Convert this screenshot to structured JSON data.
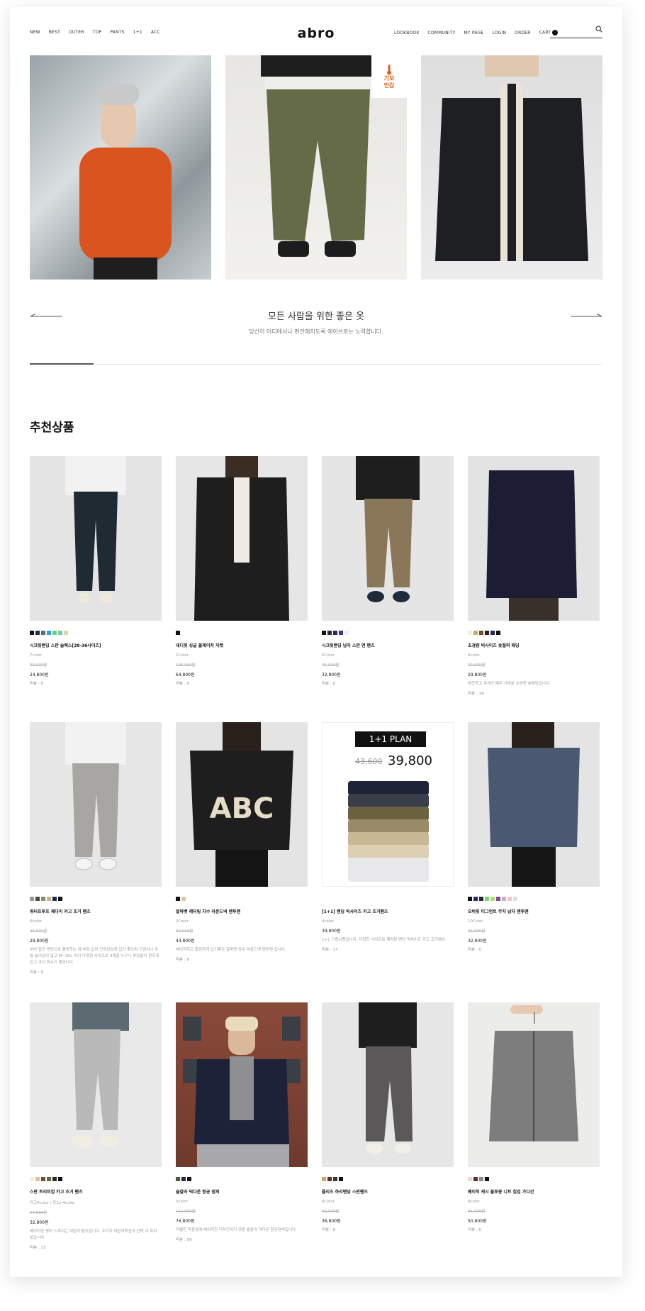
{
  "header": {
    "logo": "abro",
    "nav_left": [
      "NEW",
      "BEST",
      "OUTER",
      "TOP",
      "PANTS",
      "1+1",
      "ACC"
    ],
    "nav_right": [
      "LOOKBOOK",
      "COMMUNITY",
      "MY PAGE",
      "LOGIN",
      "ORDER",
      "CART"
    ],
    "cart_count": "0"
  },
  "hero": {
    "badge_line1": "기모",
    "badge_line2": "안감"
  },
  "slogan": {
    "title": "모든 사람을 위한 좋은 옷",
    "subtitle": "당신이 어디에서나 편안해지도록 에이브로는 노력합니다."
  },
  "section_title": "추천상품",
  "products": [
    {
      "name": "시크릿밴딩 스판 슬랙스[28-36사이즈]",
      "colors_label": "7color",
      "orig": "33,000원",
      "price": "24,800원",
      "desc": "",
      "review": "리뷰 : 0",
      "swatches": [
        "#111111",
        "#1d2a55",
        "#5b6a7a",
        "#2aa4e0",
        "#6ad17a",
        "#7bc9a8",
        "#dcd5b0"
      ]
    },
    {
      "name": "데디핏 싱글 블레이저 자켓",
      "colors_label": "1Color",
      "orig": "105,000원",
      "price": "64,800원",
      "desc": "",
      "review": "리뷰 : 0",
      "swatches": [
        "#111111"
      ]
    },
    {
      "name": "시크릿밴딩 남자 스판 면 팬츠",
      "colors_label": "5Color",
      "orig": "45,000원",
      "price": "32,800원",
      "desc": "",
      "review": "리뷰 : 0",
      "swatches": [
        "#111111",
        "#2b2b2b",
        "#1d2a6e",
        "#3a3a8a",
        "#f0f0f0"
      ]
    },
    {
      "name": "초경량 빅사이즈 숏절퍼 패딩",
      "colors_label": "6color",
      "orig": "42,000원",
      "price": "29,800원",
      "desc": "따뜻하고 무게가 매우 가벼운 초경량 숏패딩입니다.",
      "review": "리뷰 : 14",
      "swatches": [
        "#f3efe2",
        "#c8a96a",
        "#6b5330",
        "#2a1f14",
        "#1d2a55",
        "#111111"
      ]
    },
    {
      "name": "워터프루프 제다이 카고 조거 팬츠",
      "colors_label": "6color",
      "orig": "45,000원",
      "price": "29,800원",
      "desc": "허리 밑단 밴딩으로 활동하는 데 부담 없이 안정감있게 입기 좋으며 구김이나 무릎 늘어남이 없고 M~3XL 까지 다양한 사이즈로 4계절 누구나 부담없이 편하게 입고 코디 하시기 좋습니다.",
      "review": "리뷰 : 9",
      "swatches": [
        "#9a9a9a",
        "#4a4a4a",
        "#8a8a70",
        "#c9b48a",
        "#1d2a55",
        "#111111"
      ]
    },
    {
      "name": "알파벳 레터링 자수 라운드넥 맨투맨",
      "colors_label": "2Color",
      "orig": "69,000원",
      "price": "43,800원",
      "desc": "베이직하고 깔끔하게 입기좋은 알파벳 자수 라운드넥 맨투맨 입니다.",
      "review": "리뷰 : 0",
      "swatches": [
        "#111111",
        "#d9c6a8"
      ]
    },
    {
      "name": "[1+1] 밴딩 빅사이즈 카고 조거팬츠",
      "colors_label": "4color",
      "orig": "",
      "price": "39,800원",
      "desc": "1+1 기획상품입니다. 다양한 사이즈로 제작된 밴딩 빅사이즈 카고 조거팬츠",
      "review": "리뷰 : 17",
      "swatches": [],
      "plan_tag": "1+1 PLAN",
      "plan_old": "43,600",
      "plan_new": "39,800"
    },
    {
      "name": "오버핏 티그먼트 무지 남자 맨투맨",
      "colors_label": "10Color",
      "orig": "46,000원",
      "price": "32,800원",
      "desc": "",
      "review": "리뷰 : 0",
      "swatches": [
        "#111111",
        "#1d2a6e",
        "#2b2b2b",
        "#7bd17a",
        "#a6e07a",
        "#8e3fa8",
        "#b8b8b8",
        "#f0c0d0",
        "#e0e0e0"
      ]
    },
    {
      "name": "스판 트리미엄 카고 조거 팬츠",
      "colors_label": "카고4color / 트1o-4color",
      "orig": "54,000원",
      "price": "32,800원",
      "desc": "베이직한 핏이 느껴지는 데일리 팬츠입니다. 두거지 타입의쪽입이 선택 이 특이 넣습니다.",
      "review": "리뷰 : 13",
      "swatches": [
        "#f3efe2",
        "#d9c39a",
        "#6b5330",
        "#5b6a3a",
        "#2b2b2b",
        "#111111"
      ]
    },
    {
      "name": "숄칼라 덕다운 항공 점퍼",
      "colors_label": "3color",
      "orig": "111,000원",
      "price": "76,800원",
      "desc": "덕웰한 착용감에 베이직한 디자인까지 갖춘 숄칼라 덕다운 항공점퍼입니다.",
      "review": "리뷰 : 59",
      "swatches": [
        "#4a5a3a",
        "#1d2a55",
        "#111111"
      ]
    },
    {
      "name": "플리츠 하리밴딩 스판팬츠",
      "colors_label": "4Color",
      "orig": "60,000원",
      "price": "36,800원",
      "desc": "",
      "review": "리뷰 : 0",
      "swatches": [
        "#c8a96a",
        "#6b2a2a",
        "#3a3a3a",
        "#111111"
      ]
    },
    {
      "name": "베이직 캐시 블루종 니트 집업 가디건",
      "colors_label": "4color",
      "orig": "81,000원",
      "price": "50,800원",
      "desc": "",
      "review": "리뷰 : 0",
      "swatches": [
        "#e8d8c8",
        "#6b2a2a",
        "#8a8a8a",
        "#111111"
      ]
    }
  ]
}
